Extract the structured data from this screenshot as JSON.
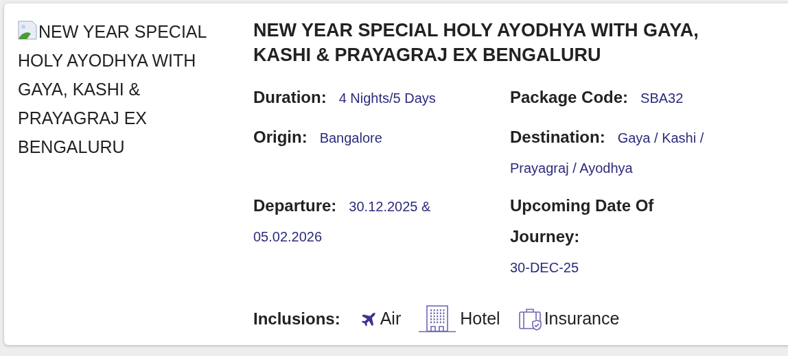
{
  "image": {
    "alt": "NEW YEAR SPECIAL HOLY AYODHYA WITH GAYA, KASHI & PRAYAGRAJ EX BENGALURU"
  },
  "title": "NEW YEAR SPECIAL HOLY AYODHYA WITH GAYA, KASHI & PRAYAGRAJ EX BENGALURU",
  "fields": [
    {
      "kind": "inline",
      "label": "Duration:",
      "value": "4 Nights/5 Days"
    },
    {
      "kind": "inline",
      "label": "Package Code:",
      "value": "SBA32"
    },
    {
      "kind": "inline",
      "label": "Origin:",
      "value": "Bangalore"
    },
    {
      "kind": "inline",
      "label": "Destination:",
      "value": "Gaya / Kashi /",
      "value_continued": "Prayagraj / Ayodhya"
    },
    {
      "kind": "inline",
      "label": "Departure:",
      "value": "30.12.2025 &",
      "value_continued": "05.02.2026"
    },
    {
      "kind": "stacked",
      "label": "Upcoming Date Of Journey:",
      "value": "30-DEC-25"
    }
  ],
  "inclusions": {
    "label": "Inclusions:",
    "items": [
      {
        "kind": "air",
        "label": "Air"
      },
      {
        "kind": "hotel",
        "label": "Hotel"
      },
      {
        "kind": "insurance",
        "label": "Insurance"
      }
    ]
  }
}
